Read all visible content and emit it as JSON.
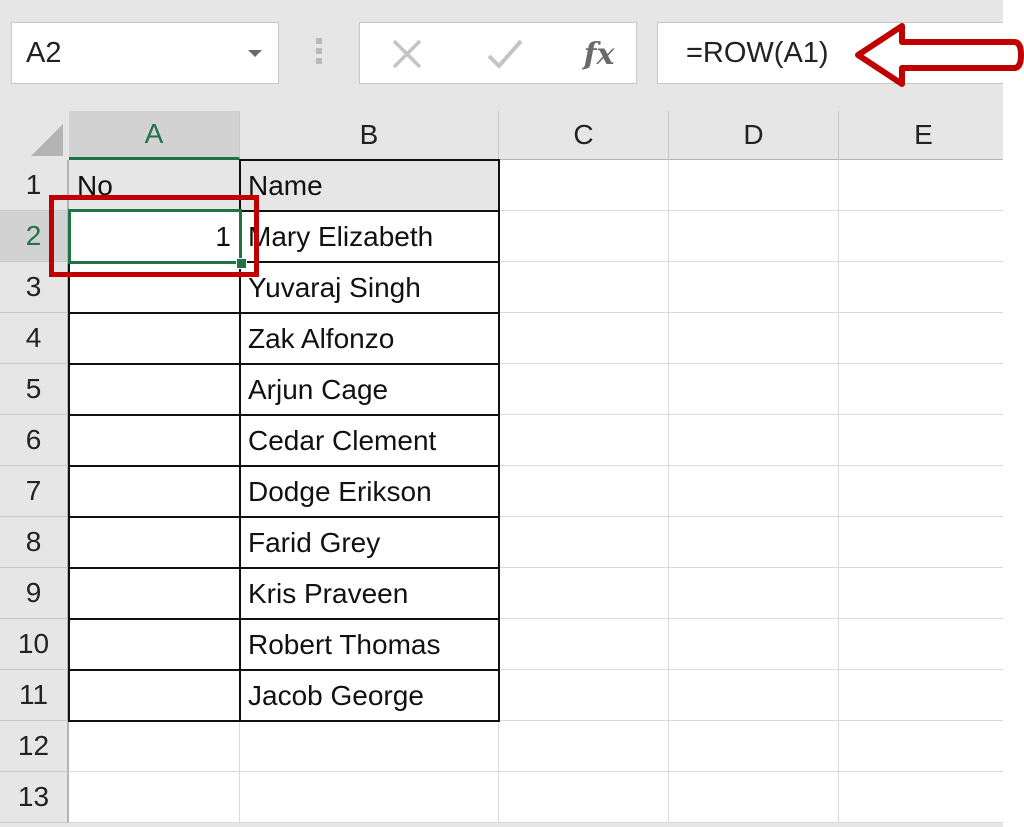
{
  "formula_bar": {
    "name_box": "A2",
    "cancel_icon": "close-icon",
    "enter_icon": "check-icon",
    "fx_label": "fx",
    "formula": "=ROW(A1)"
  },
  "columns": [
    "A",
    "B",
    "C",
    "D",
    "E"
  ],
  "selected_column": "A",
  "rows": [
    {
      "num": "1",
      "A": "No",
      "B": "Name"
    },
    {
      "num": "2",
      "A": "1",
      "B": "Mary Elizabeth"
    },
    {
      "num": "3",
      "A": "",
      "B": "Yuvaraj Singh"
    },
    {
      "num": "4",
      "A": "",
      "B": "Zak Alfonzo"
    },
    {
      "num": "5",
      "A": "",
      "B": "Arjun Cage"
    },
    {
      "num": "6",
      "A": "",
      "B": "Cedar Clement"
    },
    {
      "num": "7",
      "A": "",
      "B": "Dodge Erikson"
    },
    {
      "num": "8",
      "A": "",
      "B": "Farid Grey"
    },
    {
      "num": "9",
      "A": "",
      "B": "Kris Praveen"
    },
    {
      "num": "10",
      "A": "",
      "B": "Robert Thomas"
    },
    {
      "num": "11",
      "A": "",
      "B": "Jacob George"
    },
    {
      "num": "12",
      "A": "",
      "B": ""
    },
    {
      "num": "13",
      "A": "",
      "B": ""
    }
  ],
  "selected_cell": "A2",
  "colors": {
    "excel_green": "#217346",
    "annotation_red": "#c00000"
  }
}
